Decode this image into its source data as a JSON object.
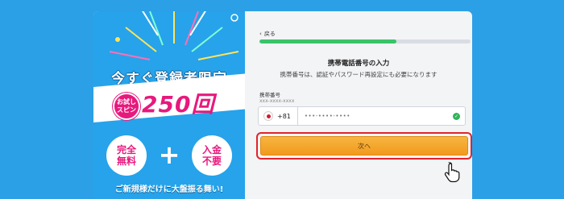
{
  "promo": {
    "headline": "今すぐ登録者限定",
    "trial_badge": "お試しスピン",
    "spin_count": "250回",
    "benefit_1": "完全無料",
    "plus": "+",
    "benefit_2": "入金不要",
    "tagline": "ご新規様だけに大盤振る舞い!"
  },
  "form": {
    "back_label": "戻る",
    "progress": 0.65,
    "title": "携帯電話番号の入力",
    "description": "携帯番号は、認証やパスワード再設定にも必要になります",
    "phone_label": "携帯番号",
    "phone_hint": "xxx-xxxx-xxxx",
    "country_code": "+81",
    "phone_value": "•••-••••-••••",
    "valid_icon": "check-circle-icon",
    "next_button": "次へ"
  },
  "colors": {
    "page_bg": "#2ba0e6",
    "promo_accent": "#e7197d",
    "progress": "#39c46a",
    "button": "#f19a1e",
    "highlight": "#e3232b"
  }
}
